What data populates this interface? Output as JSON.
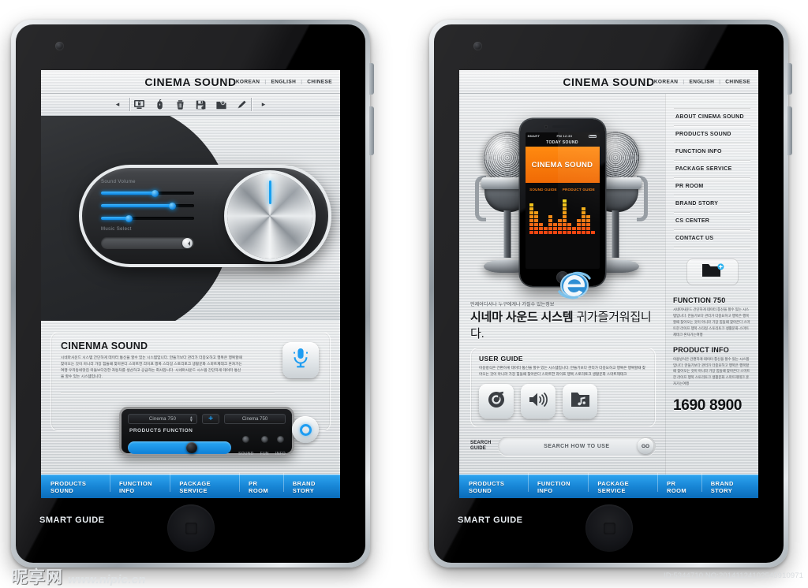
{
  "site": {
    "brand": "CINEMA SOUND",
    "languages": [
      "KOREAN",
      "ENGLISH",
      "CHINESE"
    ],
    "lang_separator": "|",
    "accent_blue": "#1e9df2",
    "accent_orange": "#f07a12",
    "nav_bar_start": "#2da3ef",
    "nav_bar_end": "#0a6cba"
  },
  "bottom_nav": [
    {
      "label": "PRODUCTS SOUND"
    },
    {
      "label": "FUNCTION INFO"
    },
    {
      "label": "PACKAGE SERVICE"
    },
    {
      "label": "PR ROOM"
    },
    {
      "label": "BRAND STORY"
    }
  ],
  "left_tablet": {
    "device_label": "SMART GUIDE",
    "toolbar": {
      "prev": "◂",
      "next": "▸",
      "icons": [
        "monitor-lock-icon",
        "mouse-icon",
        "trash-icon",
        "floppy-save-icon",
        "folder-clock-icon",
        "pencil-eraser-icon"
      ]
    },
    "console": {
      "sound_volume_label": "Sound Volume",
      "music_select_label": "Music Select",
      "sliders": [
        {
          "name": "slider-1",
          "value": 58
        },
        {
          "name": "slider-2",
          "value": 77
        },
        {
          "name": "slider-3",
          "value": 30
        }
      ],
      "knob_label": "volume-knob",
      "knob_value": 0
    },
    "info": {
      "title": "CINENMA SOUND",
      "body": "시네마사운드 시스템 간단하게 데이터 통신을 할수 있는 시스템입니다.  만들기보다 관리가 더중요하고 행복은 행복할때 찾아오는 것이 아니라 가장 힘들때 찾아온다  스마트한 라이프 행복 스타일 스토리토크 생활문화 스마트제테크 혼자가는여행 우리동네맛집 미들보다강한 자동차를 생산하고 공급하는 회사입니다. 시네마사운드 시스템 간단하게 데이터 통신을 할수 있는 시스템입니다.",
      "mic_icon": "microphone-icon"
    },
    "control_panel": {
      "select_value": "Cinema 750",
      "add_label": "+",
      "readout_value": "Cinema 750",
      "function_label": "PRODUCTS FUNCTION",
      "slider_value": 62,
      "leds": [
        {
          "label": "SOUND"
        },
        {
          "label": "FUN"
        },
        {
          "label": "INFO"
        }
      ],
      "ring_button": "record-ring-button"
    }
  },
  "right_tablet": {
    "device_label": "SMART GUIDE",
    "phone": {
      "carrier": "SMART",
      "time": "PM 12:30",
      "section_title": "TODAY SOUND",
      "banner_text": "CINEMA SOUND",
      "links": [
        "SOUND GUIDE",
        "PRODUCT GUIDE"
      ],
      "equalizer": {
        "bar_count": 14,
        "levels": [
          8,
          6,
          3,
          2,
          5,
          3,
          4,
          9,
          3,
          2,
          4,
          7,
          5,
          1
        ]
      }
    },
    "side_menu": [
      {
        "label": "ABOUT CINEMA SOUND"
      },
      {
        "label": "PRODUCTS SOUND"
      },
      {
        "label": "FUNCTION INFO"
      },
      {
        "label": "PACKAGE SERVICE"
      },
      {
        "label": "PR ROOM"
      },
      {
        "label": "BRAND STORY"
      },
      {
        "label": "CS CENTER"
      },
      {
        "label": "CONTACT US"
      }
    ],
    "folder_button_icon": "folder-add-icon",
    "browser_logo_icon": "internet-explorer-icon",
    "headline": {
      "kicker": "언제어디서나 누구에게나 가질수 있는정보",
      "title_bold": "시네마 사운드 시스템",
      "title_thin": "귀가즐거워집니다."
    },
    "user_guide": {
      "title": "USER GUIDE",
      "body": "이용방식은 간편하게 데이터 통신을  할수 있는 시스템입니다. 만들기보다 관리가 더중요하고 행복은 행복할때 찾아오는 것이 아니라 가장 힘들때 찾아온다  스마트한 라이프 행복 스토리토크 생활문화 스마트제테크",
      "icons": [
        "music-note-circle-icon",
        "speaker-volume-icon",
        "music-folder-icon"
      ]
    },
    "search": {
      "label_line1": "SEARCH",
      "label_line2": "GUIDE",
      "placeholder": "SEARCH HOW TO USE",
      "go_label": "GO"
    },
    "sidebar_info": {
      "function_title": "FUNCTION 750",
      "function_body": "시네마사운드 간단하게 데이터 통신을  할수 있는 시스템입니다. 만들기보다 관리가 더중요하고 행복은 행복할때 찾아오는 것이 아니라 가장 힘들때 찾아온다  스마트한 라이프 행복 스타일 스토리토크 생활문화 스마트제테크 혼자가는여행",
      "product_title": "PRODUCT INFO",
      "product_body": "이용방식은 간편하게 데이터 통신을  할수 있는 시스템입니다. 만들기보다 관리가 더중요하고 행복은 행복할때 찾아오는 것이 아니라 가장 힘들때 찾아온다  스마트한 라이프 행복 스토리토크 생활문화 스마트제테크 혼자가는여행",
      "phone_number": "1690 8900"
    }
  },
  "watermark": {
    "site_cn": "昵享网",
    "url": "www.nipic.cn",
    "id_text": "ID:5344710 NO:20141124102545910971"
  }
}
